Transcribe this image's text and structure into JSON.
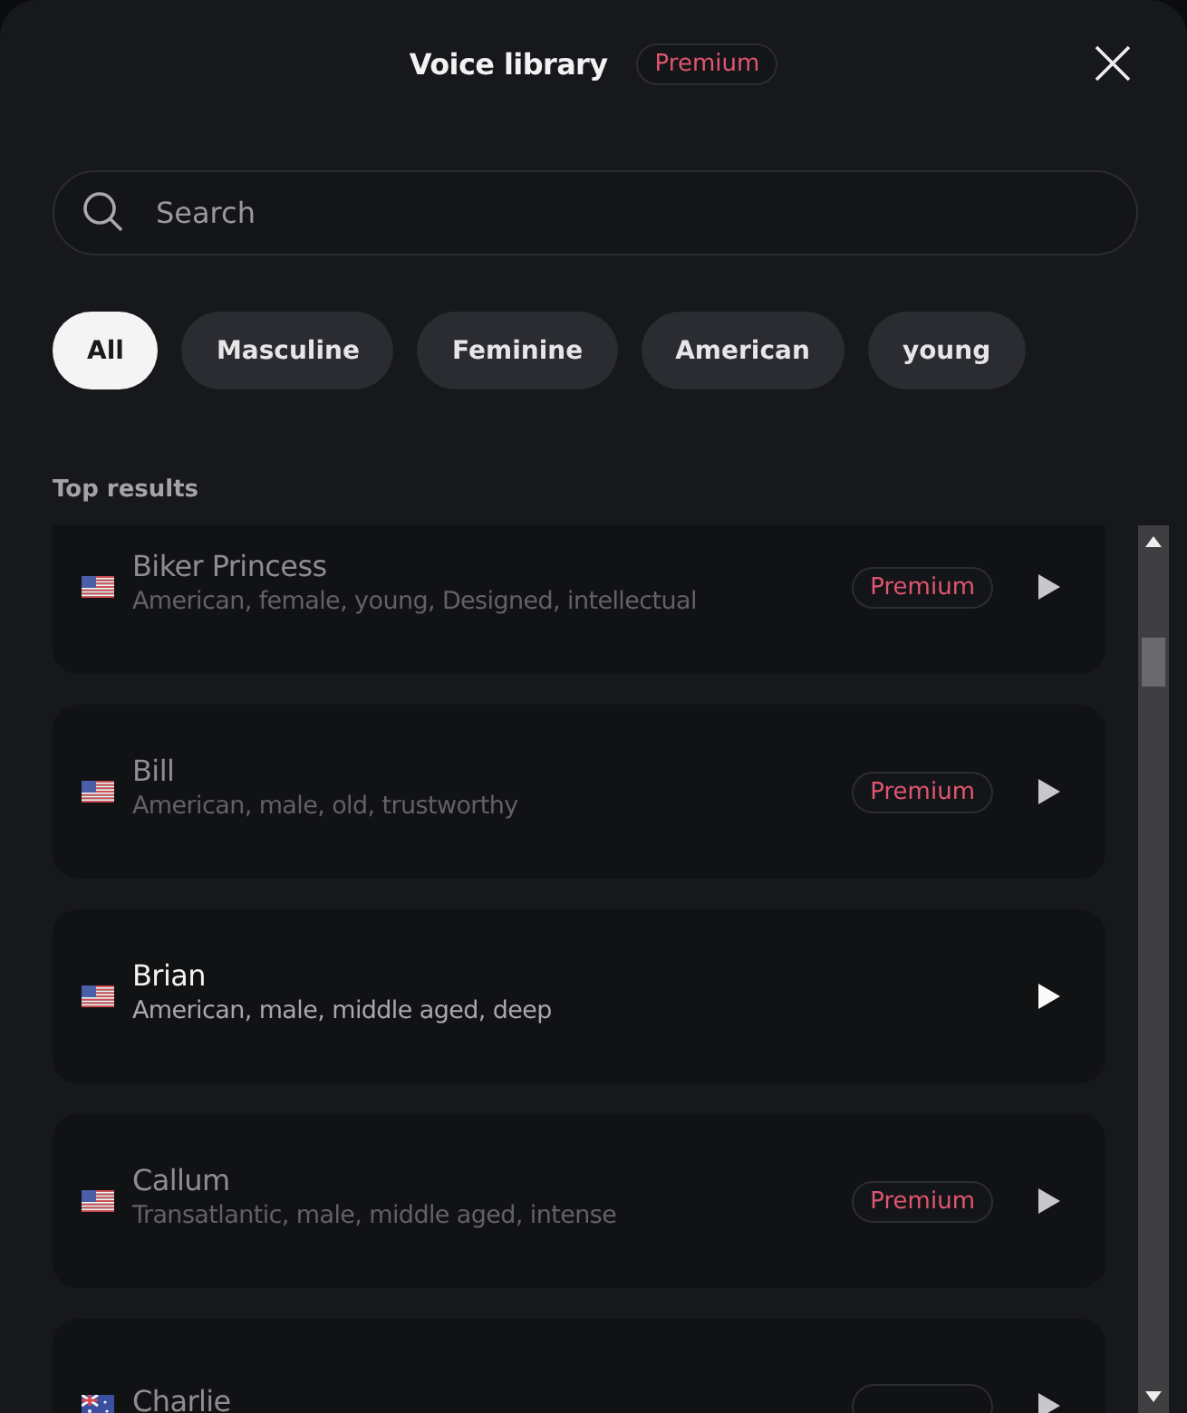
{
  "header": {
    "title": "Voice library",
    "badge": "Premium"
  },
  "search": {
    "placeholder": "Search"
  },
  "filters": [
    {
      "label": "All",
      "selected": true
    },
    {
      "label": "Masculine",
      "selected": false
    },
    {
      "label": "Feminine",
      "selected": false
    },
    {
      "label": "American",
      "selected": false
    },
    {
      "label": "young",
      "selected": false
    }
  ],
  "section_title": "Top results",
  "voices": [
    {
      "kind": "us",
      "name": "Biker Princess",
      "description": "American, female, young, Designed, intellectual",
      "locked": true,
      "badge": "Premium"
    },
    {
      "kind": "us",
      "name": "Bill",
      "description": "American, male, old, trustworthy",
      "locked": true,
      "badge": "Premium"
    },
    {
      "kind": "us",
      "name": "Brian",
      "description": "American, male, middle aged, deep",
      "locked": false
    },
    {
      "kind": "us",
      "name": "Callum",
      "description": "Transatlantic, male, middle aged, intense",
      "locked": true,
      "badge": "Premium"
    },
    {
      "kind": "au",
      "name": "Charlie",
      "locked": true
    }
  ]
}
